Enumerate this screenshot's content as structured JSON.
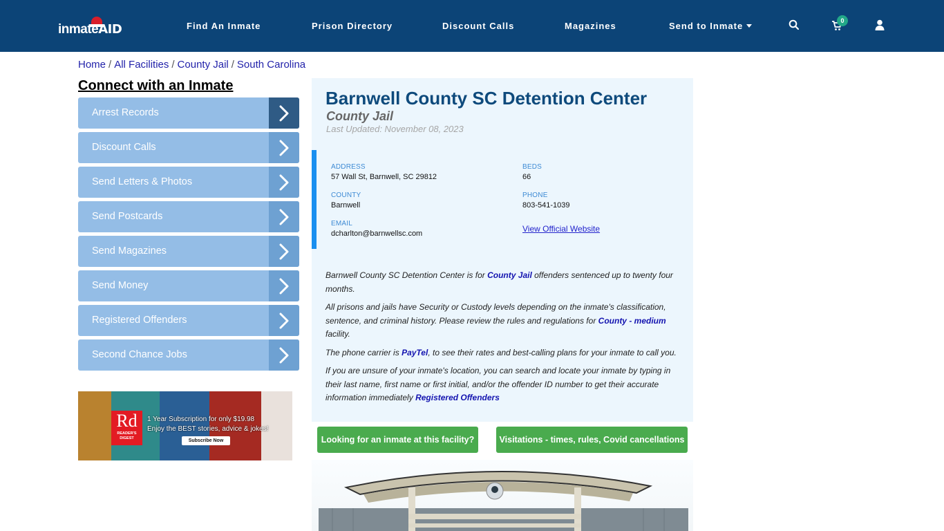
{
  "header": {
    "logo": {
      "text_left": "inmate",
      "text_right": "AID"
    },
    "nav": [
      {
        "label": "Find An Inmate"
      },
      {
        "label": "Prison Directory"
      },
      {
        "label": "Discount Calls"
      },
      {
        "label": "Magazines"
      },
      {
        "label": "Send to Inmate",
        "has_dropdown": true
      }
    ],
    "icons": {
      "search": "search-icon",
      "cart": "cart-icon",
      "user": "user-icon"
    },
    "cart_count": "0"
  },
  "breadcrumb": [
    {
      "label": "Home"
    },
    {
      "label": "All Facilities"
    },
    {
      "label": "County Jail"
    },
    {
      "label": "South Carolina"
    }
  ],
  "sidebar": {
    "title": "Connect with an Inmate",
    "items": [
      {
        "label": "Arrest Records",
        "active": true
      },
      {
        "label": "Discount Calls"
      },
      {
        "label": "Send Letters & Photos"
      },
      {
        "label": "Send Postcards"
      },
      {
        "label": "Send Magazines"
      },
      {
        "label": "Send Money"
      },
      {
        "label": "Registered Offenders"
      },
      {
        "label": "Second Chance Jobs"
      }
    ],
    "ad": {
      "logo_big": "Rd",
      "logo_small": "READER'S DIGEST",
      "line1": "1 Year Subscription for only $19.98",
      "line2": "Enjoy the BEST stories, advice & jokes!",
      "cta": "Subscribe Now"
    }
  },
  "facility": {
    "name": "Barnwell County SC Detention Center",
    "type": "County Jail",
    "last_updated": "Last Updated: November 08, 2023",
    "fields": {
      "address": {
        "label": "ADDRESS",
        "value": "57 Wall St, Barnwell, SC 29812"
      },
      "beds": {
        "label": "BEDS",
        "value": "66"
      },
      "county": {
        "label": "COUNTY",
        "value": "Barnwell"
      },
      "phone": {
        "label": "PHONE",
        "value": "803-541-1039"
      },
      "email": {
        "label": "EMAIL",
        "value": "dcharlton@barnwellsc.com"
      },
      "website_link": "View Official Website"
    },
    "description": {
      "p1_a": "Barnwell County SC Detention Center is for ",
      "p1_link": "County Jail",
      "p1_b": " offenders sentenced up to twenty four months.",
      "p2_a": "All prisons and jails have Security or Custody levels depending on the inmate's classification, sentence, and criminal history. Please review the rules and regulations for ",
      "p2_link": "County - medium",
      "p2_b": " facility.",
      "p3_a": "The phone carrier is ",
      "p3_link": "PayTel",
      "p3_b": ", to see their rates and best-calling plans for your inmate to call you.",
      "p4_a": "If you are unsure of your inmate's location, you can search and locate your inmate by typing in their last name, first name or first initial, and/or the offender ID number to get their accurate information immediately ",
      "p4_link": "Registered Offenders"
    },
    "buttons": {
      "find_inmate": "Looking for an inmate at this facility?",
      "visitation": "Visitations - times, rules, Covid cancellations"
    }
  },
  "colors": {
    "header_bg": "#0c4477",
    "sidebar_item": "#94bde6",
    "sidebar_arrow": "#6ea1d2",
    "sidebar_arrow_active": "#2f5b85",
    "panel_bg": "#ecf6fd",
    "accent_bar": "#1a8ff0",
    "green_button": "#4aab4e",
    "title": "#0e4a7c"
  }
}
